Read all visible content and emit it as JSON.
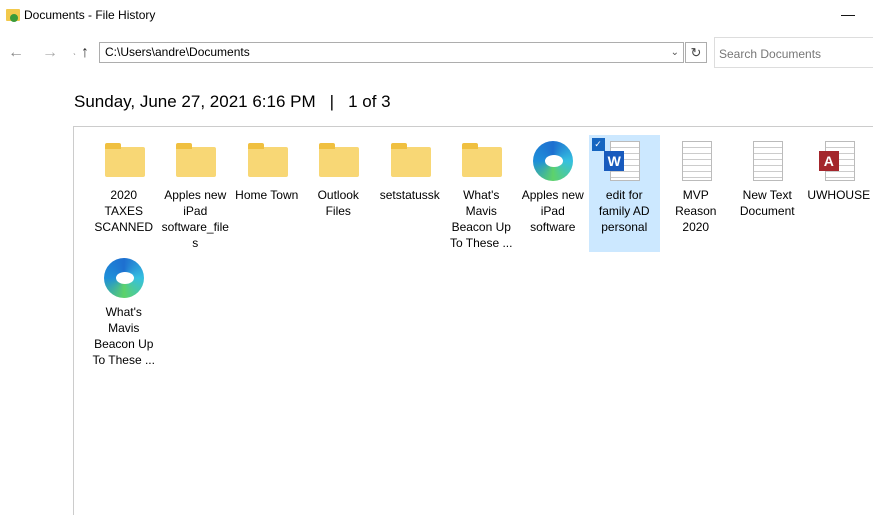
{
  "window": {
    "title": "Documents - File History"
  },
  "nav": {
    "address": "C:\\Users\\andre\\Documents",
    "search_placeholder": "Search Documents"
  },
  "header": {
    "date": "Sunday, June 27, 2021 6:16 PM",
    "separator": "|",
    "page": "1 of 3"
  },
  "items": [
    {
      "label": "2020 TAXES SCANNED",
      "type": "folder"
    },
    {
      "label": "Apples new iPad software_files",
      "type": "folder"
    },
    {
      "label": "Home Town",
      "type": "folder"
    },
    {
      "label": "Outlook Files",
      "type": "folder"
    },
    {
      "label": "setstatussk",
      "type": "folder"
    },
    {
      "label": "What's Mavis Beacon Up To These ...",
      "type": "folder"
    },
    {
      "label": "Apples new iPad software",
      "type": "edge"
    },
    {
      "label": "edit for family AD personal",
      "type": "word",
      "selected": true
    },
    {
      "label": "MVP Reason 2020",
      "type": "text"
    },
    {
      "label": "New Text Document",
      "type": "text"
    },
    {
      "label": "UWHOUSE",
      "type": "access"
    },
    {
      "label": "What's Mavis Beacon Up To These ...",
      "type": "edge"
    }
  ]
}
